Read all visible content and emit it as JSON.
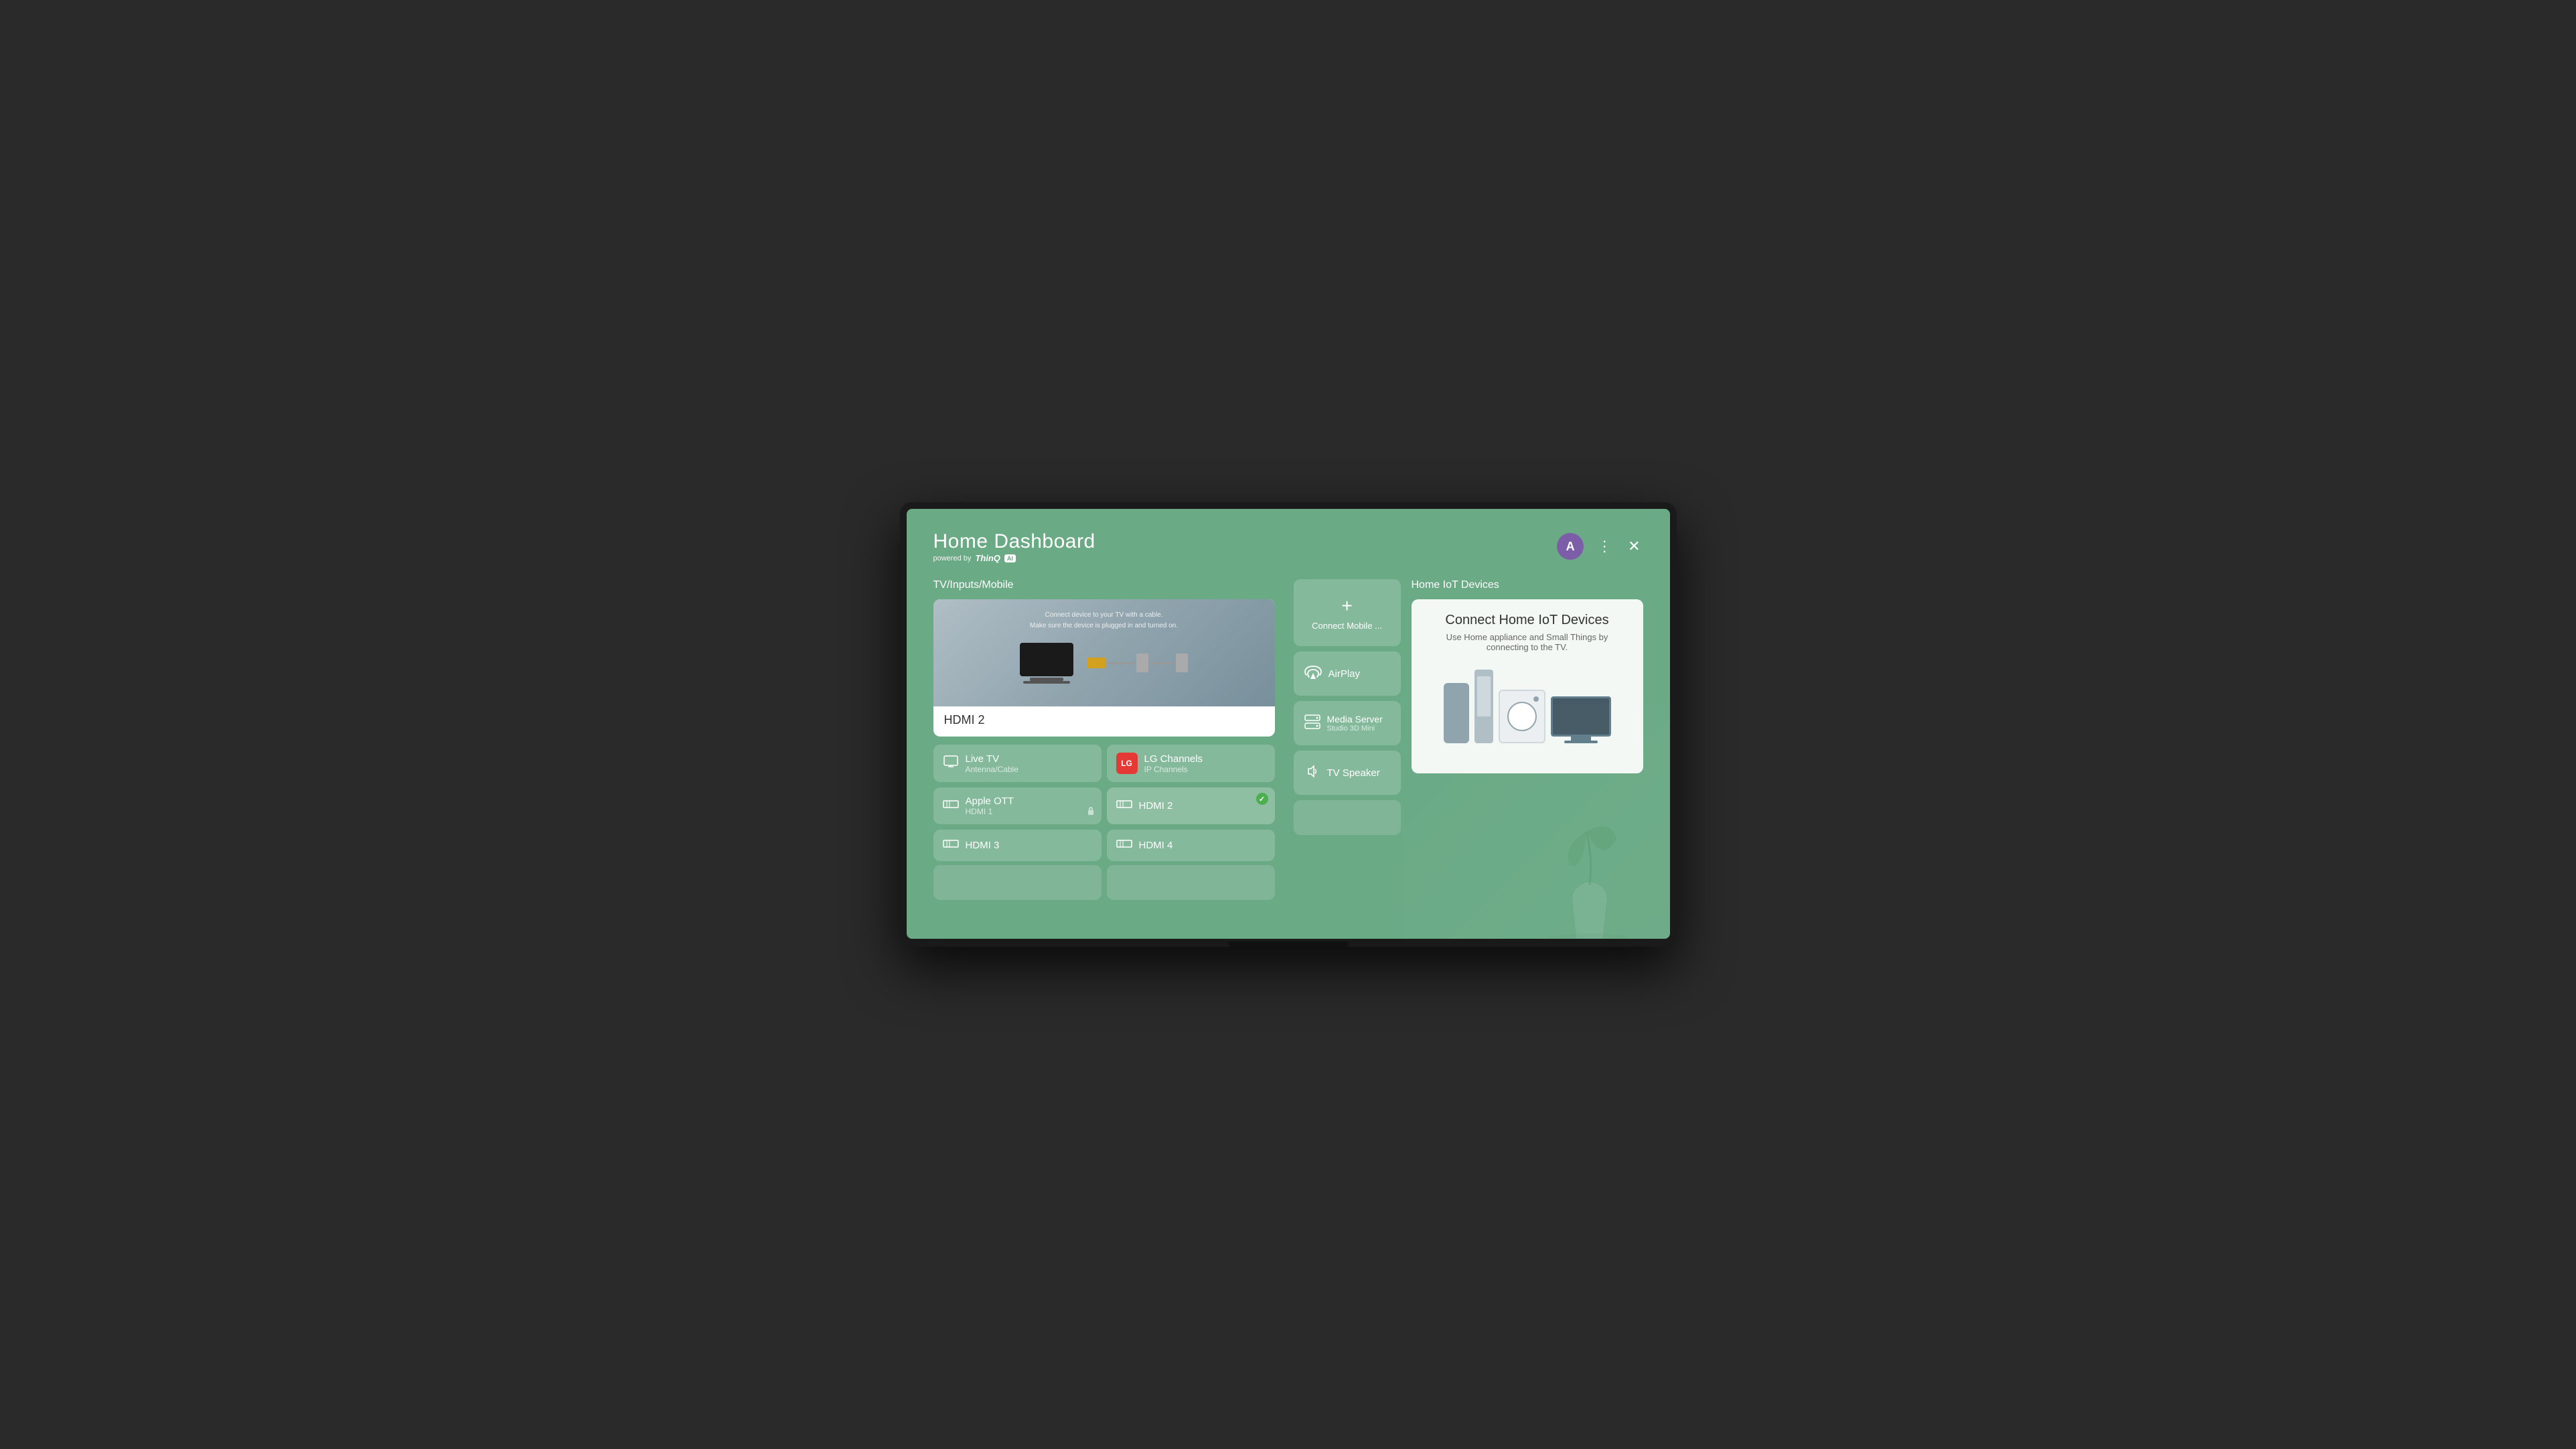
{
  "header": {
    "title": "Home Dashboard",
    "powered_by": "powered by",
    "brand": "ThinQ",
    "ai_badge": "AI",
    "avatar_letter": "A",
    "more_icon": "⋮",
    "close_icon": "✕"
  },
  "tv_inputs": {
    "section_title": "TV/Inputs/Mobile",
    "featured": {
      "caption_line1": "Connect device to your TV with a cable.",
      "caption_line2": "Make sure the device is plugged in and turned on.",
      "label": "HDMI 2"
    },
    "items": [
      {
        "id": "live-tv",
        "name": "Live TV",
        "sub": "Antenna/Cable",
        "icon": "tv"
      },
      {
        "id": "lg-channels",
        "name": "LG Channels",
        "sub": "IP Channels",
        "icon": "lg"
      },
      {
        "id": "apple-ott",
        "name": "Apple OTT",
        "sub": "HDMI 1",
        "icon": "apple",
        "lock": true
      },
      {
        "id": "hdmi2",
        "name": "HDMI 2",
        "sub": "",
        "icon": "hdmi",
        "active": true
      },
      {
        "id": "hdmi3",
        "name": "HDMI 3",
        "sub": "",
        "icon": "hdmi"
      },
      {
        "id": "hdmi4",
        "name": "HDMI 4",
        "sub": "",
        "icon": "hdmi"
      }
    ]
  },
  "connect_options": {
    "items": [
      {
        "id": "connect-mobile",
        "label": "Connect Mobile ...",
        "icon": "plus",
        "type": "plus"
      },
      {
        "id": "airplay",
        "label": "AirPlay",
        "icon": "airplay"
      },
      {
        "id": "media-server",
        "label": "Media Server",
        "sub": "Studio 3D Mini",
        "icon": "server"
      },
      {
        "id": "tv-speaker",
        "label": "TV Speaker",
        "icon": "speaker"
      }
    ]
  },
  "iot": {
    "section_title": "Home IoT Devices",
    "card_title": "Connect Home IoT Devices",
    "card_subtitle": "Use Home appliance and Small Things by connecting to the TV."
  },
  "colors": {
    "bg_green": "#6aaa85",
    "card_bg": "rgba(255,255,255,0.18)",
    "avatar_purple": "#7b5ea7",
    "active_green": "#4caf50"
  }
}
